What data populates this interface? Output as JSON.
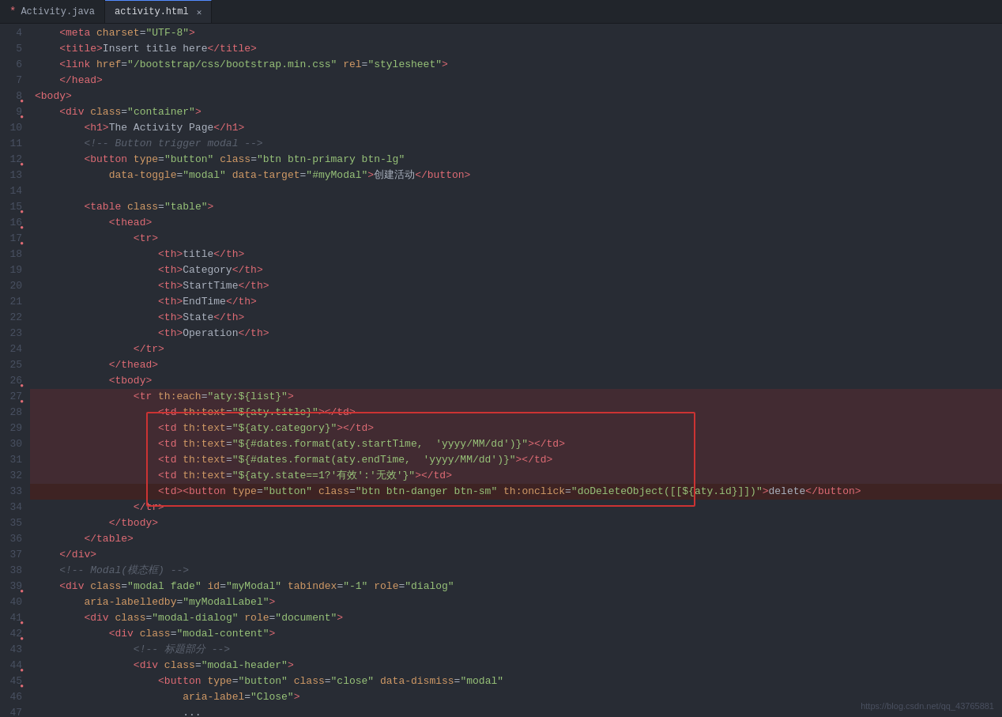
{
  "tabs": [
    {
      "label": "*Activity.java",
      "active": false,
      "modified": true,
      "id": "activity-java"
    },
    {
      "label": "activity.html",
      "active": true,
      "modified": false,
      "id": "activity-html",
      "closeable": true
    }
  ],
  "editor": {
    "filename": "activity.html",
    "lines": [
      {
        "num": 4,
        "dot": false,
        "content": "meta_charset"
      },
      {
        "num": 5,
        "dot": false,
        "content": "title_line"
      },
      {
        "num": 6,
        "dot": false,
        "content": "link_line"
      },
      {
        "num": 7,
        "dot": false,
        "content": "head_close"
      },
      {
        "num": 8,
        "dot": true,
        "content": "body_open"
      },
      {
        "num": 9,
        "dot": true,
        "content": "div_container"
      },
      {
        "num": 10,
        "dot": false,
        "content": "h1_line"
      },
      {
        "num": 11,
        "dot": false,
        "content": "comment_button"
      },
      {
        "num": 12,
        "dot": true,
        "content": "button_open"
      },
      {
        "num": 13,
        "dot": false,
        "content": "button_data"
      },
      {
        "num": 14,
        "dot": false,
        "content": "blank"
      },
      {
        "num": 15,
        "dot": true,
        "content": "table_open"
      },
      {
        "num": 16,
        "dot": true,
        "content": "thead_open"
      },
      {
        "num": 17,
        "dot": true,
        "content": "tr_open"
      },
      {
        "num": 18,
        "dot": false,
        "content": "th_title"
      },
      {
        "num": 19,
        "dot": false,
        "content": "th_category"
      },
      {
        "num": 20,
        "dot": false,
        "content": "th_starttime"
      },
      {
        "num": 21,
        "dot": false,
        "content": "th_endtime"
      },
      {
        "num": 22,
        "dot": false,
        "content": "th_state"
      },
      {
        "num": 23,
        "dot": false,
        "content": "th_operation"
      },
      {
        "num": 24,
        "dot": false,
        "content": "tr_close"
      },
      {
        "num": 25,
        "dot": false,
        "content": "thead_close"
      },
      {
        "num": 26,
        "dot": true,
        "content": "tbody_open"
      },
      {
        "num": 27,
        "dot": true,
        "content": "tr_each"
      },
      {
        "num": 28,
        "dot": false,
        "content": "td_title"
      },
      {
        "num": 29,
        "dot": false,
        "content": "td_category"
      },
      {
        "num": 30,
        "dot": false,
        "content": "td_starttime"
      },
      {
        "num": 31,
        "dot": false,
        "content": "td_endtime"
      },
      {
        "num": 32,
        "dot": false,
        "content": "td_state"
      },
      {
        "num": 33,
        "dot": false,
        "content": "td_button"
      },
      {
        "num": 34,
        "dot": false,
        "content": "tr_close2"
      },
      {
        "num": 35,
        "dot": false,
        "content": "tbody_close"
      },
      {
        "num": 36,
        "dot": false,
        "content": "table_close"
      },
      {
        "num": 37,
        "dot": false,
        "content": "div_close"
      },
      {
        "num": 38,
        "dot": false,
        "content": "comment_modal"
      },
      {
        "num": 39,
        "dot": true,
        "content": "div_modal"
      },
      {
        "num": 40,
        "dot": false,
        "content": "aria_labelledby"
      },
      {
        "num": 41,
        "dot": true,
        "content": "div_modal_dialog"
      },
      {
        "num": 42,
        "dot": true,
        "content": "div_modal_content"
      },
      {
        "num": 43,
        "dot": false,
        "content": "comment_title"
      },
      {
        "num": 44,
        "dot": true,
        "content": "div_modal_header"
      },
      {
        "num": 45,
        "dot": true,
        "content": "button_close"
      },
      {
        "num": 46,
        "dot": false,
        "content": "aria_label"
      },
      {
        "num": 47,
        "dot": false,
        "content": "ellipsis"
      }
    ],
    "watermark": "https://blog.csdn.net/qq_43765881"
  }
}
